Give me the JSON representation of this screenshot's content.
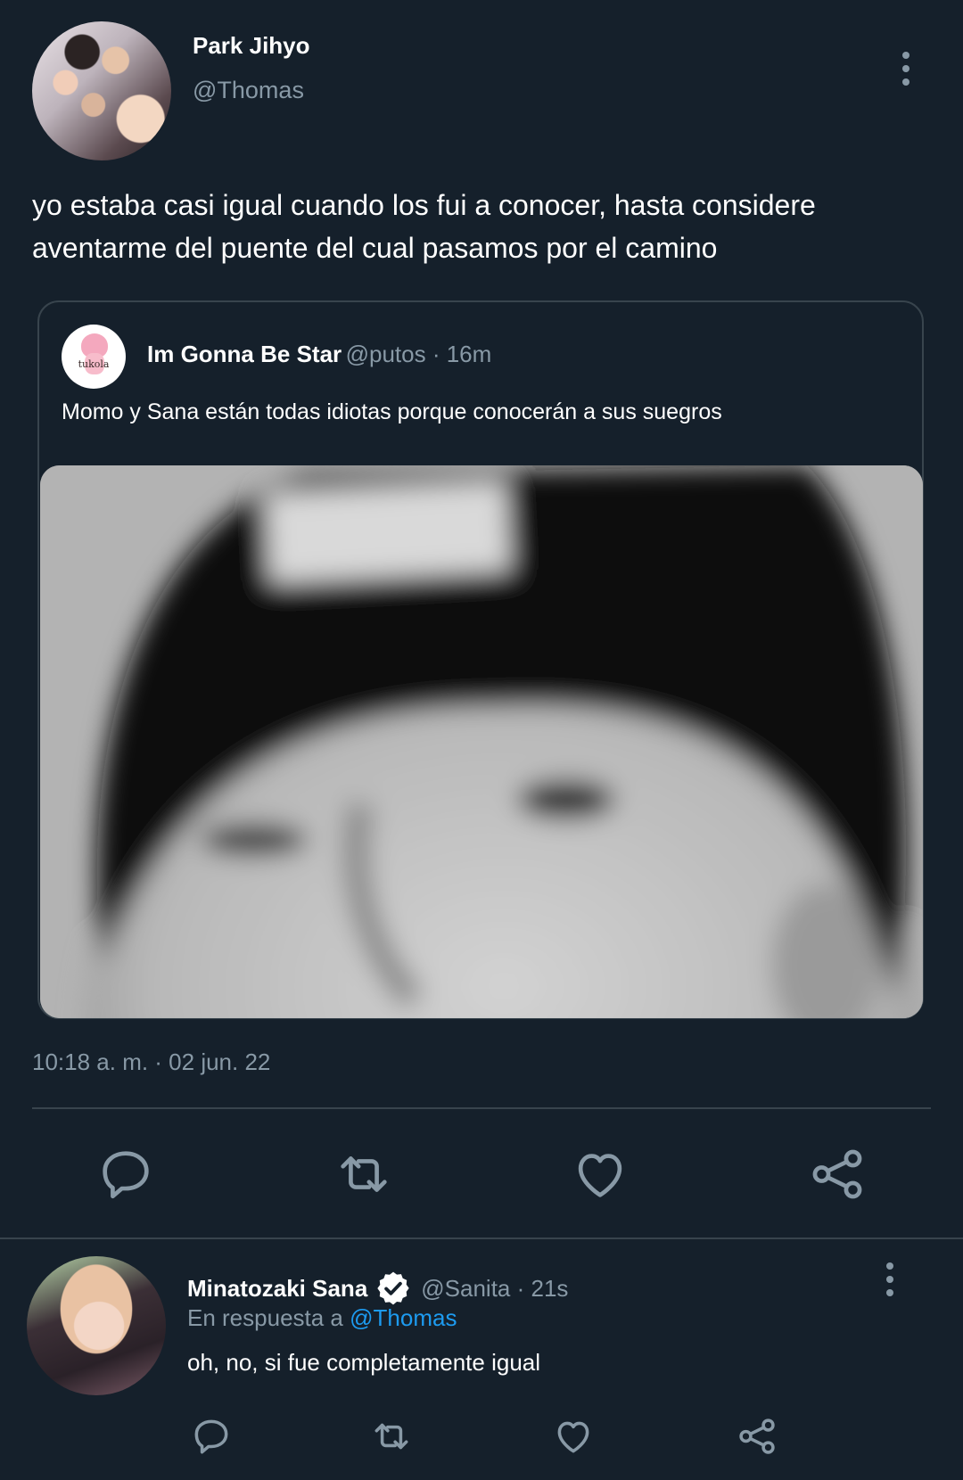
{
  "tweet": {
    "author_name": "Park Jihyo",
    "author_handle": "@Thomas",
    "text_line1": "yo estaba casi igual cuando los fui a conocer, hasta considere",
    "text_line2": "aventarme del puente del cual pasamos por el camino",
    "timestamp": "10:18 a. m. · 02 jun. 22"
  },
  "quoted": {
    "author_name": "Im Gonna Be Star",
    "meta": "@putos · 16m",
    "avatar_text": "tukola",
    "text": "Momo y Sana están todas idiotas porque conocerán a sus suegros"
  },
  "actions": [
    "reply-icon",
    "retweet-icon",
    "like-icon",
    "share-icon"
  ],
  "reply": {
    "author_name": "Minatozaki Sana",
    "meta": "@Sanita · 21s",
    "reply_prefix": "En respuesta a",
    "reply_to": "@Thomas",
    "text": "oh, no, si fue completamente igual"
  },
  "colors": {
    "background": "#15202b",
    "secondary_text": "#8899a6",
    "border": "#38444d",
    "link": "#1d9bf0"
  }
}
